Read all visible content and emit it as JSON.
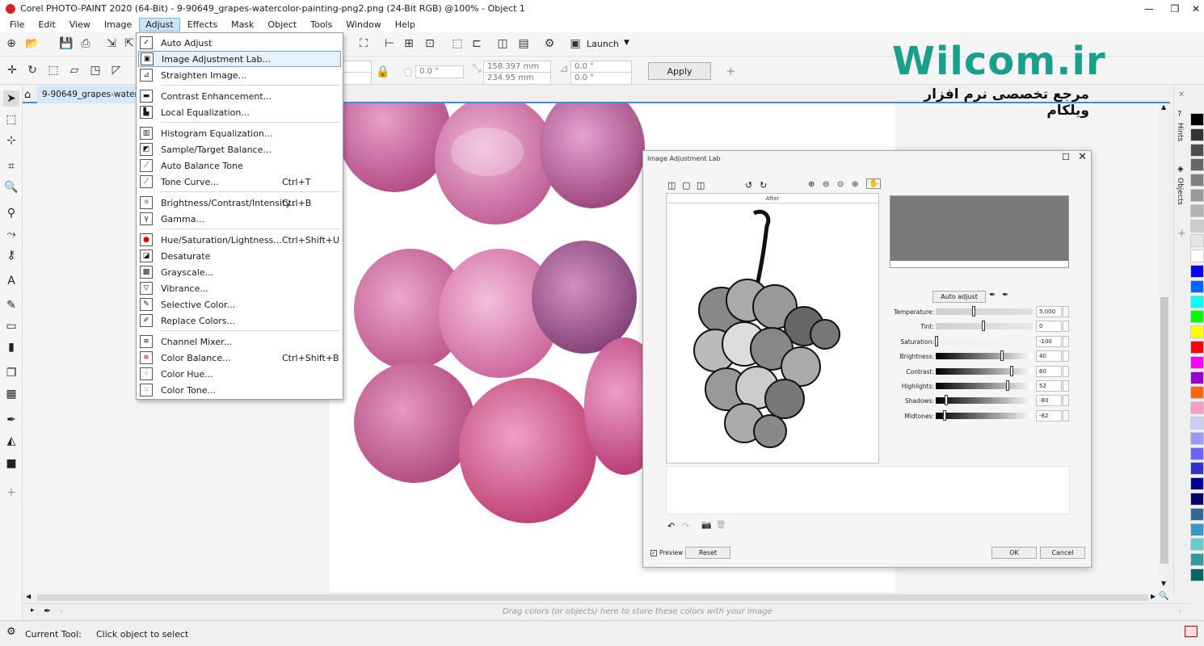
{
  "window": {
    "title": "Corel PHOTO-PAINT 2020 (64-Bit) - 9-90649_grapes-watercolor-painting-png2.png (24-Bit RGB) @100% - Object 1",
    "minimize": "—",
    "maximize": "❐",
    "close": "✕"
  },
  "menubar": {
    "items": [
      "File",
      "Edit",
      "View",
      "Image",
      "Adjust",
      "Effects",
      "Mask",
      "Object",
      "Tools",
      "Window",
      "Help"
    ]
  },
  "toolbar": {
    "launch_label": "Launch",
    "apply_label": "Apply",
    "width_value": "158.397 mm",
    "height_value": "234.95 mm",
    "rotation_value": "0.0 °",
    "skew_h_value": "0.0 °",
    "skew_v_value": "0.0 °",
    "left_value": "0.0 °",
    "add_icon": "+"
  },
  "document": {
    "tab_label": "9-90649_grapes-waterco..."
  },
  "adjust_menu": {
    "items": [
      {
        "label": "Auto Adjust",
        "shortcut": ""
      },
      {
        "label": "Image Adjustment Lab...",
        "shortcut": ""
      },
      {
        "label": "Straighten Image...",
        "shortcut": ""
      },
      {
        "label": "Contrast Enhancement...",
        "shortcut": ""
      },
      {
        "label": "Local Equalization...",
        "shortcut": ""
      },
      {
        "label": "Histogram Equalization...",
        "shortcut": ""
      },
      {
        "label": "Sample/Target Balance...",
        "shortcut": ""
      },
      {
        "label": "Auto Balance Tone",
        "shortcut": ""
      },
      {
        "label": "Tone Curve...",
        "shortcut": "Ctrl+T"
      },
      {
        "label": "Brightness/Contrast/Intensity...",
        "shortcut": "Ctrl+B"
      },
      {
        "label": "Gamma...",
        "shortcut": ""
      },
      {
        "label": "Hue/Saturation/Lightness...",
        "shortcut": "Ctrl+Shift+U"
      },
      {
        "label": "Desaturate",
        "shortcut": ""
      },
      {
        "label": "Grayscale...",
        "shortcut": ""
      },
      {
        "label": "Vibrance...",
        "shortcut": ""
      },
      {
        "label": "Selective Color...",
        "shortcut": ""
      },
      {
        "label": "Replace Colors...",
        "shortcut": ""
      },
      {
        "label": "Channel Mixer...",
        "shortcut": ""
      },
      {
        "label": "Color Balance...",
        "shortcut": "Ctrl+Shift+B"
      },
      {
        "label": "Color Hue...",
        "shortcut": ""
      },
      {
        "label": "Color Tone...",
        "shortcut": ""
      }
    ]
  },
  "dialog": {
    "title": "Image Adjustment Lab",
    "preview_header": "After",
    "auto_adjust_label": "Auto adjust",
    "sliders": [
      {
        "label": "Temperature:",
        "value": "5,000",
        "position": 0.4
      },
      {
        "label": "Tint:",
        "value": "0",
        "position": 0.5
      },
      {
        "label": "Saturation:",
        "value": "-100",
        "position": 0.0
      },
      {
        "label": "Brightness:",
        "value": "40",
        "position": 0.7
      },
      {
        "label": "Contrast:",
        "value": "60",
        "position": 0.8
      },
      {
        "label": "Highlights:",
        "value": "52",
        "position": 0.76
      },
      {
        "label": "Shadows:",
        "value": "-80",
        "position": 0.1
      },
      {
        "label": "Midtones:",
        "value": "-82",
        "position": 0.09
      }
    ],
    "preview_checkbox_label": "Preview",
    "reset_label": "Reset",
    "ok_label": "OK",
    "cancel_label": "Cancel"
  },
  "docker": {
    "tabs": [
      "Hints",
      "Objects"
    ]
  },
  "colorbar": {
    "hint": "Drag colors (or objects) here to store these colors with your image"
  },
  "status": {
    "tool_label": "Current Tool:",
    "tool_value": "Click object to select"
  },
  "watermark": {
    "title": "Wilcom.ir",
    "subtitle": "مرجع تخصصی نرم افزار ویلکام"
  },
  "palette": {
    "colors": [
      "#000000",
      "#333333",
      "#4d4d4d",
      "#666666",
      "#808080",
      "#999999",
      "#b3b3b3",
      "#cccccc",
      "#e6e6e6",
      "#ffffff",
      "#0000ff",
      "#0066ff",
      "#00ffff",
      "#00ff00",
      "#ffff00",
      "#ff0000",
      "#ff00ff",
      "#9900cc",
      "#ff6600",
      "#ff99cc",
      "#ccccff",
      "#9999ff",
      "#6666ff",
      "#3333cc",
      "#000099",
      "#000066",
      "#336699",
      "#3399cc",
      "#66cccc",
      "#339999",
      "#006666"
    ]
  }
}
